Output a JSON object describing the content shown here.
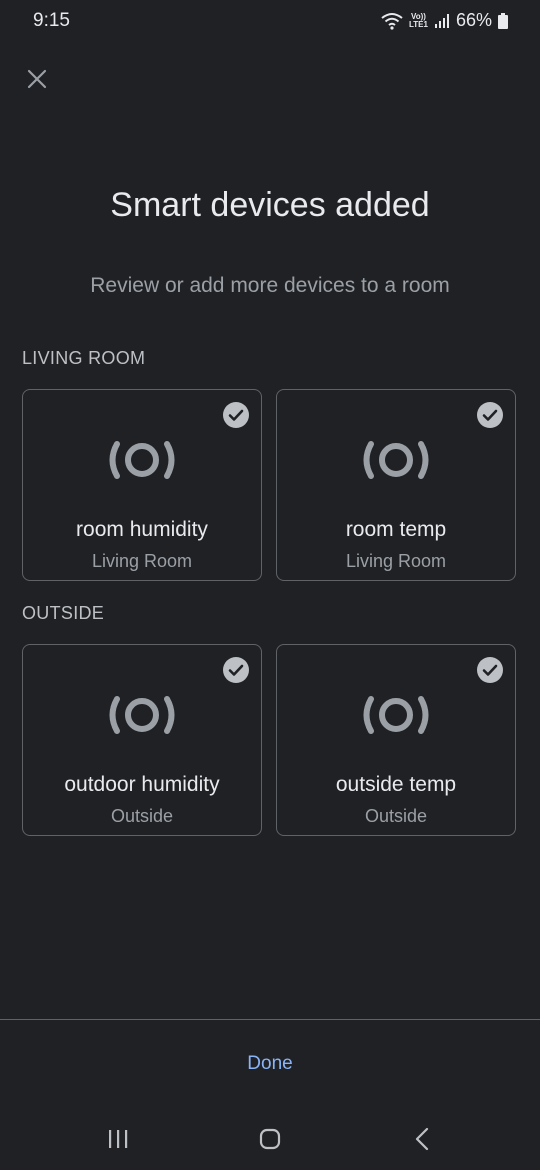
{
  "status_bar": {
    "time": "9:15",
    "battery": "66%",
    "network_label_top": "Vo))",
    "network_label_bottom": "LTE1"
  },
  "header": {
    "title": "Smart devices added",
    "subtitle": "Review or add more devices to a room"
  },
  "sections": [
    {
      "label": "LIVING ROOM",
      "devices": [
        {
          "name": "room humidity",
          "room": "Living Room",
          "selected": true
        },
        {
          "name": "room temp",
          "room": "Living Room",
          "selected": true
        }
      ]
    },
    {
      "label": "OUTSIDE",
      "devices": [
        {
          "name": "outdoor humidity",
          "room": "Outside",
          "selected": true
        },
        {
          "name": "outside temp",
          "room": "Outside",
          "selected": true
        }
      ]
    }
  ],
  "footer": {
    "done_label": "Done"
  },
  "colors": {
    "background": "#202124",
    "accent": "#8ab4f8",
    "check_badge": "#bdc1c6"
  },
  "icons": [
    "close-icon",
    "sensor-icon",
    "check-circle-icon",
    "recents-icon",
    "home-icon",
    "back-icon",
    "wifi-icon",
    "signal-icon",
    "battery-icon"
  ]
}
